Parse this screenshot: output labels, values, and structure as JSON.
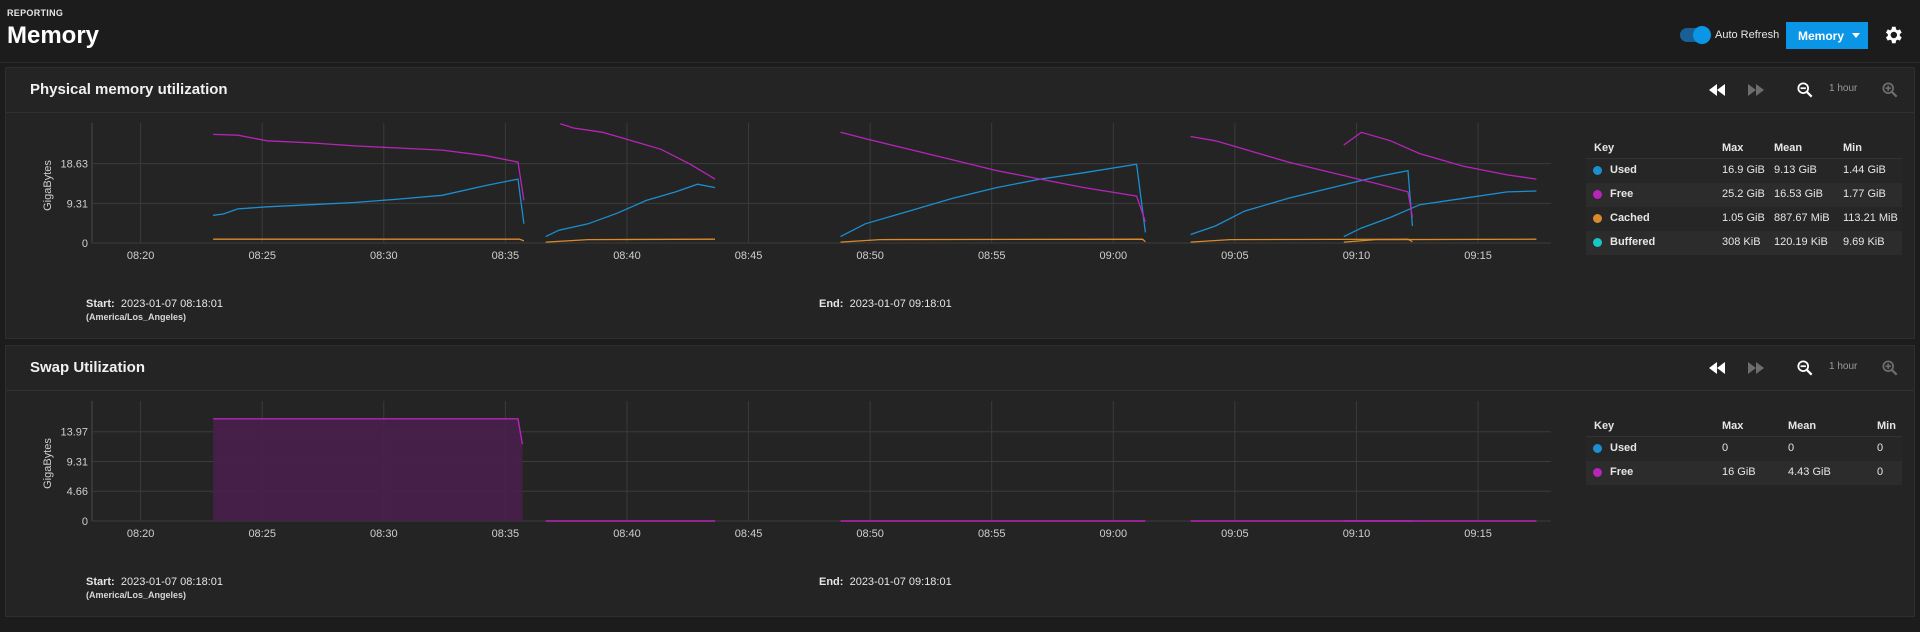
{
  "header": {
    "breadcrumb": "REPORTING",
    "title": "Memory",
    "auto_refresh_label": "Auto Refresh",
    "auto_refresh_on": true,
    "report_select": "Memory",
    "settings_icon": "gear-icon"
  },
  "colors": {
    "accent": "#0a95e6",
    "used": "#1b8fd0",
    "free": "#b624b8",
    "cached": "#d98b2b",
    "buffered": "#17c6c6"
  },
  "panels": [
    {
      "title": "Physical memory utilization",
      "zoom_label": "1 hour",
      "y_axis_label": "GigaBytes",
      "start_label": "Start:",
      "start_value": "2023-01-07 08:18:01",
      "timezone": "(America/Los_Angeles)",
      "end_label": "End:",
      "end_value": "2023-01-07 09:18:01",
      "legend": {
        "headers": [
          "Key",
          "Max",
          "Mean",
          "Min"
        ],
        "rows": [
          {
            "name": "Used",
            "max": "16.9 GiB",
            "mean": "9.13 GiB",
            "min": "1.44 GiB",
            "color": "#1b8fd0"
          },
          {
            "name": "Free",
            "max": "25.2 GiB",
            "mean": "16.53 GiB",
            "min": "1.77 GiB",
            "color": "#b624b8"
          },
          {
            "name": "Cached",
            "max": "1.05 GiB",
            "mean": "887.67 MiB",
            "min": "113.21 MiB",
            "color": "#d98b2b"
          },
          {
            "name": "Buffered",
            "max": "308 KiB",
            "mean": "120.19 KiB",
            "min": "9.69 KiB",
            "color": "#17c6c6"
          }
        ]
      }
    },
    {
      "title": "Swap Utilization",
      "zoom_label": "1 hour",
      "y_axis_label": "GigaBytes",
      "start_label": "Start:",
      "start_value": "2023-01-07 08:18:01",
      "timezone": "(America/Los_Angeles)",
      "end_label": "End:",
      "end_value": "2023-01-07 09:18:01",
      "legend": {
        "headers": [
          "Key",
          "Max",
          "Mean",
          "Min"
        ],
        "rows": [
          {
            "name": "Used",
            "max": "0",
            "mean": "0",
            "min": "0",
            "color": "#1b8fd0"
          },
          {
            "name": "Free",
            "max": "16 GiB",
            "mean": "4.43 GiB",
            "min": "0",
            "color": "#b624b8"
          }
        ]
      }
    }
  ],
  "chart_data": [
    {
      "type": "line",
      "ylabel": "GigaBytes",
      "x_ticks": [
        "08:20",
        "08:25",
        "08:30",
        "08:35",
        "08:40",
        "08:45",
        "08:50",
        "08:55",
        "09:00",
        "09:05",
        "09:10",
        "09:15"
      ],
      "y_ticks": [
        0,
        9.31,
        18.63
      ],
      "xlim": [
        "08:18",
        "09:18"
      ],
      "ylim": [
        0,
        27
      ],
      "grid": true,
      "series": [
        {
          "name": "Used",
          "color": "#1b8fd0",
          "segments": [
            [
              [
                8.3,
                6.5
              ],
              [
                9,
                6.8
              ],
              [
                10,
                8
              ],
              [
                12,
                8.5
              ],
              [
                15,
                9
              ],
              [
                18,
                9.5
              ],
              [
                21,
                10.3
              ],
              [
                24,
                11.2
              ],
              [
                27,
                13.5
              ],
              [
                29.2,
                15
              ],
              [
                29.6,
                4.5
              ]
            ],
            [
              [
                31.1,
                1.5
              ],
              [
                32,
                3
              ],
              [
                34,
                4.5
              ],
              [
                36,
                7
              ],
              [
                38,
                10
              ],
              [
                40,
                12
              ],
              [
                41.5,
                13.8
              ],
              [
                42.7,
                13
              ]
            ],
            [
              [
                51.3,
                1.5
              ],
              [
                53,
                4.5
              ],
              [
                56,
                7.5
              ],
              [
                59,
                10.5
              ],
              [
                62,
                13
              ],
              [
                65,
                15
              ],
              [
                68,
                16.5
              ],
              [
                71.6,
                18.5
              ],
              [
                72.2,
                2.5
              ]
            ],
            [
              [
                75.3,
                2
              ],
              [
                77,
                4
              ],
              [
                79,
                7.5
              ],
              [
                82,
                10.5
              ],
              [
                85,
                13
              ],
              [
                88,
                15.5
              ],
              [
                90.2,
                17
              ],
              [
                90.5,
                4
              ]
            ],
            [
              [
                85.8,
                1.5
              ],
              [
                87,
                3.5
              ],
              [
                89,
                6
              ],
              [
                91,
                9
              ],
              [
                94,
                10.5
              ],
              [
                97,
                12
              ],
              [
                99,
                12.2
              ]
            ]
          ]
        },
        {
          "name": "Free",
          "color": "#b624b8",
          "segments": [
            [
              [
                8.3,
                25.5
              ],
              [
                10,
                25.3
              ],
              [
                12,
                24
              ],
              [
                15,
                23.5
              ],
              [
                18,
                22.8
              ],
              [
                21,
                22.3
              ],
              [
                24,
                21.8
              ],
              [
                27,
                20.5
              ],
              [
                29.2,
                19
              ],
              [
                29.6,
                10
              ]
            ],
            [
              [
                32.1,
                28
              ],
              [
                33,
                27
              ],
              [
                35,
                26
              ],
              [
                37,
                24
              ],
              [
                39,
                22
              ],
              [
                41,
                18.5
              ],
              [
                42.7,
                15
              ]
            ],
            [
              [
                51.3,
                26
              ],
              [
                53,
                24.5
              ],
              [
                56,
                22
              ],
              [
                59,
                19.5
              ],
              [
                62,
                17
              ],
              [
                65,
                15
              ],
              [
                68,
                13
              ],
              [
                71.6,
                11
              ],
              [
                72.2,
                5
              ]
            ],
            [
              [
                75.3,
                25
              ],
              [
                77,
                24
              ],
              [
                79,
                22
              ],
              [
                82,
                19
              ],
              [
                85,
                16.5
              ],
              [
                88,
                14
              ],
              [
                90.2,
                12
              ],
              [
                90.5,
                6
              ]
            ],
            [
              [
                85.8,
                23
              ],
              [
                87,
                26
              ],
              [
                89,
                24
              ],
              [
                91,
                21
              ],
              [
                94,
                18
              ],
              [
                97,
                16
              ],
              [
                99,
                15
              ]
            ]
          ]
        },
        {
          "name": "Cached",
          "color": "#d98b2b",
          "segments": [
            [
              [
                8.3,
                0.9
              ],
              [
                29.3,
                0.9
              ],
              [
                29.6,
                0.5
              ]
            ],
            [
              [
                31.1,
                0.2
              ],
              [
                34,
                0.8
              ],
              [
                42.7,
                0.9
              ]
            ],
            [
              [
                51.3,
                0.2
              ],
              [
                54,
                0.8
              ],
              [
                72,
                0.9
              ],
              [
                72.2,
                0.3
              ]
            ],
            [
              [
                75.3,
                0.2
              ],
              [
                78,
                0.8
              ],
              [
                90.2,
                0.9
              ],
              [
                90.5,
                0.3
              ]
            ],
            [
              [
                85.8,
                0.2
              ],
              [
                88,
                0.8
              ],
              [
                99,
                0.9
              ]
            ]
          ]
        },
        {
          "name": "Buffered",
          "color": "#17c6c6",
          "segments": []
        }
      ]
    },
    {
      "type": "area",
      "ylabel": "GigaBytes",
      "x_ticks": [
        "08:20",
        "08:25",
        "08:30",
        "08:35",
        "08:40",
        "08:45",
        "08:50",
        "08:55",
        "09:00",
        "09:05",
        "09:10",
        "09:15"
      ],
      "y_ticks": [
        0,
        4.66,
        9.31,
        13.97
      ],
      "xlim": [
        "08:18",
        "09:18"
      ],
      "ylim": [
        0,
        18
      ],
      "grid": true,
      "series": [
        {
          "name": "Used",
          "color": "#1b8fd0",
          "segments": []
        },
        {
          "name": "Free",
          "color": "#b624b8",
          "area_segment": [
            [
              8.3,
              16
            ],
            [
              29.2,
              16
            ],
            [
              29.5,
              12
            ]
          ],
          "line_segments": [
            [
              [
                31.1,
                0
              ],
              [
                42.7,
                0
              ]
            ],
            [
              [
                51.3,
                0
              ],
              [
                72.2,
                0
              ]
            ],
            [
              [
                75.3,
                0
              ],
              [
                90.5,
                0
              ]
            ],
            [
              [
                85.8,
                0
              ],
              [
                99,
                0
              ]
            ]
          ]
        }
      ]
    }
  ]
}
